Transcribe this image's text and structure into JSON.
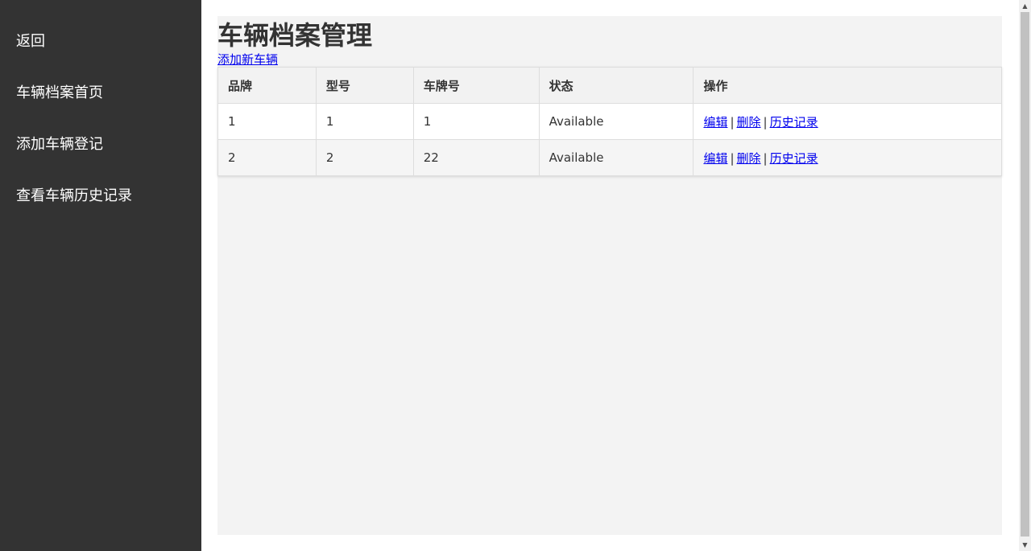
{
  "sidebar": {
    "items": [
      {
        "label": "返回"
      },
      {
        "label": "车辆档案首页"
      },
      {
        "label": "添加车辆登记"
      },
      {
        "label": "查看车辆历史记录"
      }
    ]
  },
  "main": {
    "title": "车辆档案管理",
    "add_link": "添加新车辆"
  },
  "table": {
    "headers": [
      "品牌",
      "型号",
      "车牌号",
      "状态",
      "操作"
    ],
    "rows": [
      {
        "brand": "1",
        "model": "1",
        "plate": "1",
        "status": "Available"
      },
      {
        "brand": "2",
        "model": "2",
        "plate": "22",
        "status": "Available"
      }
    ],
    "actions": {
      "edit": "编辑",
      "delete": "删除",
      "history": "历史记录",
      "separator": "|"
    }
  },
  "scrollbar": {
    "up_icon": "▲",
    "down_icon": "▼"
  }
}
